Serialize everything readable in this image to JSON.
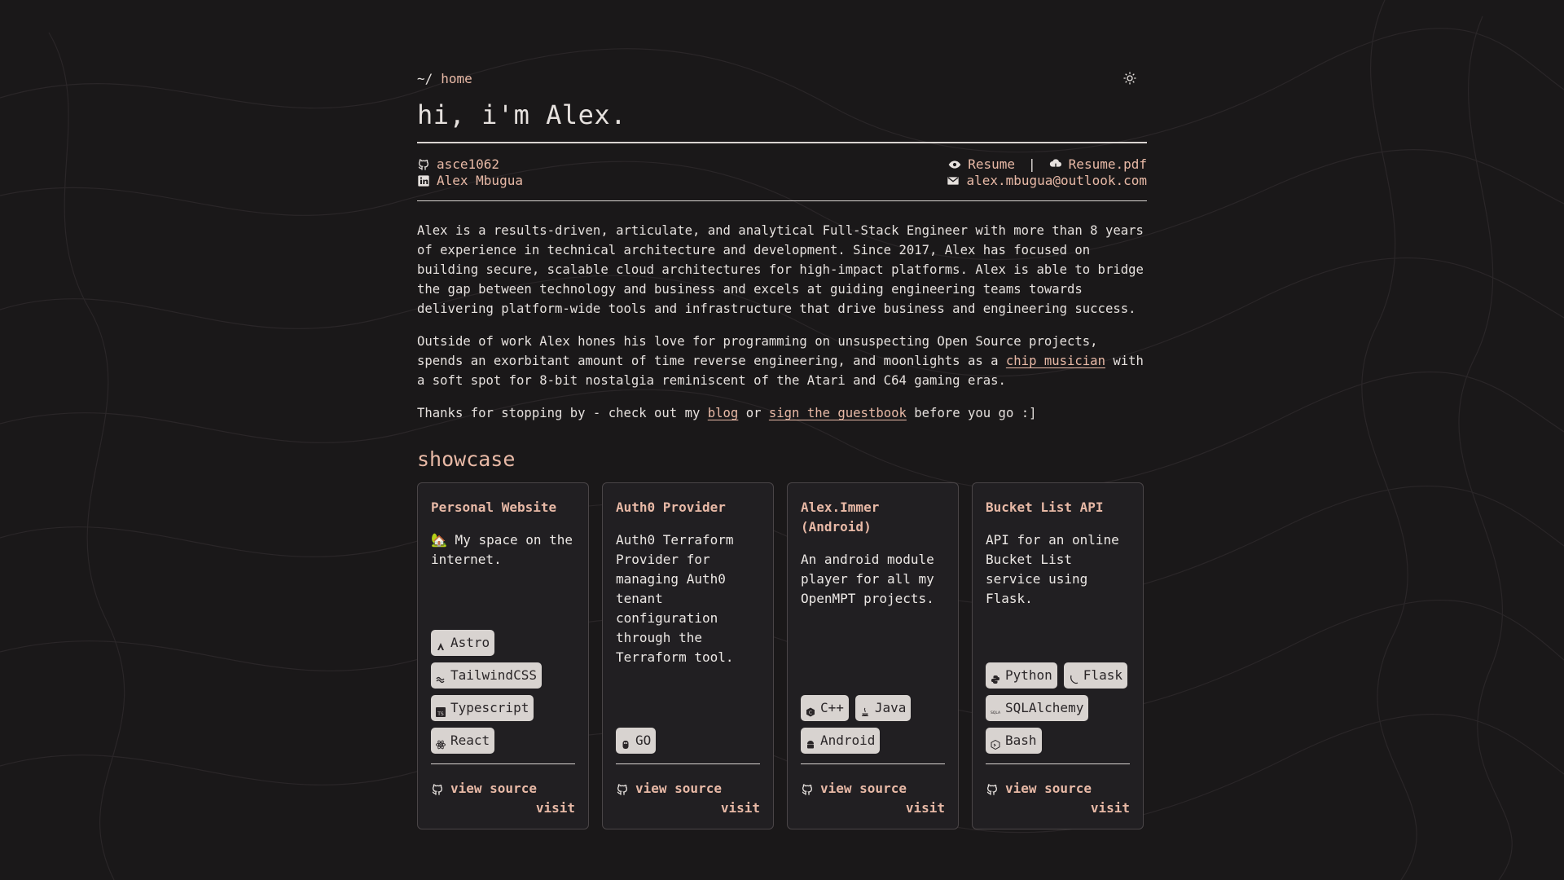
{
  "breadcrumb": {
    "prefix": "~/",
    "current": "home"
  },
  "header": {
    "title": "hi, i'm Alex."
  },
  "contacts": {
    "github": "asce1062",
    "linkedin": "Alex Mbugua",
    "resume": "Resume",
    "separator": "|",
    "resume_pdf": "Resume.pdf",
    "email": "alex.mbugua@outlook.com"
  },
  "bio": {
    "p1": "Alex is a results-driven, articulate, and analytical Full-Stack Engineer with more than 8 years of experience in technical architecture and development. Since 2017, Alex has focused on building secure, scalable cloud architectures for high-impact platforms. Alex is able to bridge the gap between technology and business and excels at guiding engineering teams towards delivering platform-wide tools and infrastructure that drive business and engineering success.",
    "p2_a": "Outside of work Alex hones his love for programming on unsuspecting Open Source projects, spends an exorbitant amount of time reverse engineering, and moonlights as a ",
    "p2_link": "chip musician",
    "p2_b": " with a soft spot for 8-bit nostalgia reminiscent of the Atari and C64 gaming eras.",
    "p3_a": "Thanks for stopping by - check out my ",
    "p3_blog": "blog",
    "p3_mid": " or ",
    "p3_guestbook": "sign the guestbook",
    "p3_b": " before you go :]"
  },
  "showcase": {
    "heading": "showcase",
    "view_source": "view source",
    "visit": "visit",
    "cards": [
      {
        "title": "Personal Website",
        "desc": "🏡 My space on the internet.",
        "tags": [
          "Astro",
          "TailwindCSS",
          "Typescript",
          "React"
        ]
      },
      {
        "title": "Auth0 Provider",
        "desc": "Auth0 Terraform Provider for managing Auth0 tenant configuration through the Terraform tool.",
        "tags": [
          "GO"
        ]
      },
      {
        "title": "Alex.Immer (Android)",
        "desc": "An android module player for all my OpenMPT projects.",
        "tags": [
          "C++",
          "Java",
          "Android"
        ]
      },
      {
        "title": "Bucket List API",
        "desc": "API for an online Bucket List service using Flask.",
        "tags": [
          "Python",
          "Flask",
          "SQLAlchemy",
          "Bash"
        ]
      }
    ]
  },
  "colors": {
    "background": "#1a1819",
    "accent": "#e8b9a6",
    "text": "#e6e1de",
    "card": "#211f22",
    "tag": "#d8d3d0"
  }
}
